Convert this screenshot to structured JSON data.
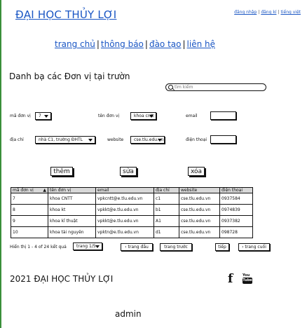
{
  "header": {
    "site_title": "ĐẠI HỌC THỦY LỢI",
    "links": {
      "login": "đăng nhập",
      "register": "đăng kí",
      "language": "tiếng việt"
    }
  },
  "nav": {
    "home": "trang chủ",
    "notices": "thông báo",
    "training": "đào tạo",
    "contact": "liên hệ"
  },
  "page_title": "Danh bạ các Đơn vị tại trườn",
  "search": {
    "placeholder": "tìm kiếm"
  },
  "filters": {
    "unit_code_label": "mã đơn vị",
    "unit_code_value": "7",
    "unit_name_label": "tên đơn vị",
    "unit_name_value": "khoa cntt",
    "email_label": "email",
    "address_label": "địa chỉ",
    "address_value": "nhà C1, trường ĐHTL",
    "website_label": "website",
    "website_value": "cse.tlu.edu.vn",
    "phone_label": "điện thoại"
  },
  "actions": {
    "add": "thêm",
    "edit": "sửa",
    "delete": "xóa"
  },
  "table": {
    "columns": [
      "mã đơn vị",
      "tên đơn vị",
      "email",
      "địa chỉ",
      "website",
      "điện thoại"
    ],
    "rows": [
      [
        "7",
        "khoa CNTT",
        "vpkcntt@e.tlu.edu.vn",
        "c1",
        "cse.tlu.edu.vn",
        "0937584"
      ],
      [
        "8",
        "khoa kt",
        "vpkkt@e.tlu.edu.vn",
        "b1",
        "cse.tlu.edu.vn",
        "0974839"
      ],
      [
        "9",
        "khoa kĩ thuật",
        "vpkkt@e.tlu.edu.vn",
        "A1",
        "cse.tlu.edu.vn",
        "0937382"
      ],
      [
        "10",
        "khoa tài nguyên",
        "vpktn@e.tlu.edu.vn",
        "d1",
        "cse.tlu.edu.vn",
        "098728"
      ]
    ]
  },
  "paging": {
    "summary": "Hiển thị 1 - 4 of 24 kết quả",
    "page_select": "trang 1/5",
    "first": "trang đầu",
    "prev": "trang trước",
    "next": "tiếp",
    "last": "trang cuối"
  },
  "footer": {
    "copyright": "2021 ĐẠI HỌC THỦY LỢI",
    "facebook_glyph": "f",
    "youtube_top": "You",
    "youtube_bottom": "Tube"
  },
  "user": "admin",
  "colors": {
    "link": "#1a56c4",
    "frame": "#3a8f3a",
    "table_header": "#d8d8d8"
  }
}
